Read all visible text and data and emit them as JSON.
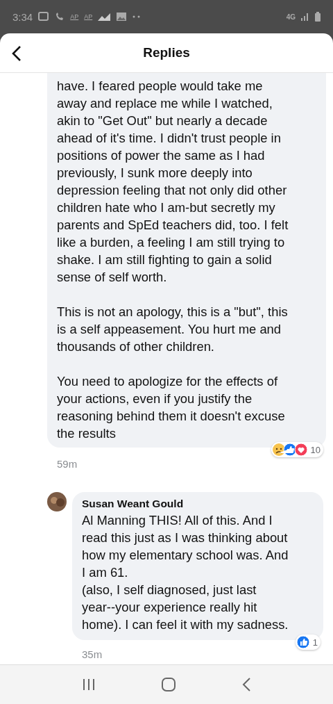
{
  "status_bar": {
    "time": "3:34",
    "notification_labels": [
      "AP",
      "AP"
    ],
    "network": "4G"
  },
  "header": {
    "title": "Replies"
  },
  "comment": {
    "paragraphs": [
      "have. I feared people would take me\naway and replace me while I watched,\nakin to \"Get Out\" but nearly a decade\nahead of it's time. I didn't trust people in\npositions of power the same as I had\npreviously, I sunk more deeply into\ndepression feeling that not only did other\nchildren hate who I am-but secretly my\nparents and SpEd teachers did, too. I felt\nlike a burden, a feeling I am still trying to\nshake. I am still fighting to gain a solid\nsense of self worth.",
      "This is not an apology, this is a \"but\", this\nis a self appeasement. You hurt me and\nthousands of other children.",
      "You need to apologize for the effects of\nyour actions, even if you justify the\nreasoning behind them it doesn't excuse\nthe results"
    ],
    "time": "59m",
    "reactions": [
      {
        "kind": "sad"
      },
      {
        "kind": "like"
      },
      {
        "kind": "love"
      }
    ],
    "reaction_count": "10"
  },
  "reply": {
    "author": "Susan Weant Gould",
    "text": "Al Manning THIS! All of this. And I\nread this just as I was thinking about\nhow my elementary school was. And\nI am 61.\n(also, I self diagnosed, just last\nyear--your experience really hit\nhome). I can feel it with my sadness.",
    "time": "35m",
    "reactions": [
      {
        "kind": "like"
      }
    ],
    "reaction_count": "1"
  }
}
